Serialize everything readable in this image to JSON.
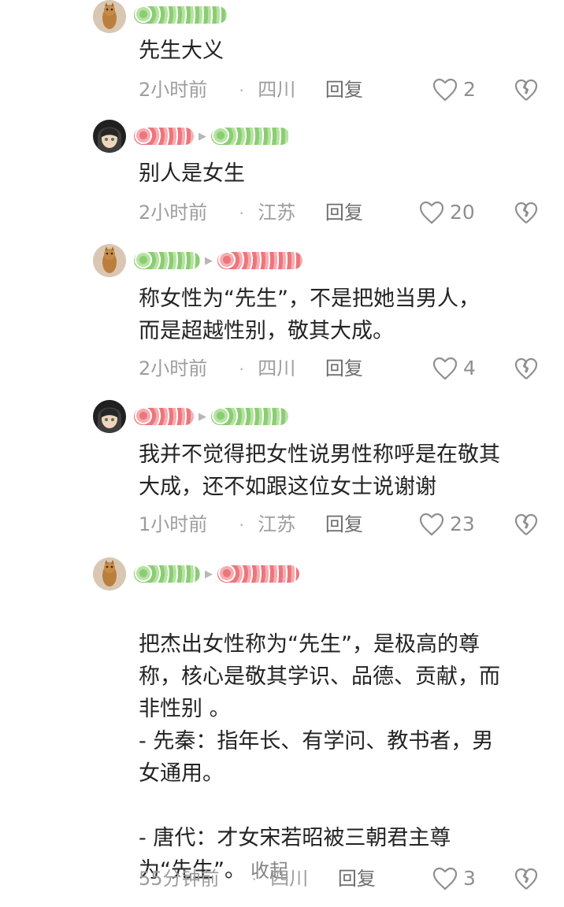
{
  "comments": [
    {
      "text": "先生大义",
      "time": "2小时前",
      "location": "四川",
      "reply_label": "回复",
      "likes": "2",
      "avatar_icon": "cat-avatar-icon"
    },
    {
      "text": "别人是女生",
      "time": "2小时前",
      "location": "江苏",
      "reply_label": "回复",
      "likes": "20",
      "avatar_icon": "anime-avatar-icon"
    },
    {
      "text": "称女性为“先生”，不是把她当男人，\n而是超越性别，敬其大成。",
      "time": "2小时前",
      "location": "四川",
      "reply_label": "回复",
      "likes": "4",
      "avatar_icon": "cat-avatar-icon"
    },
    {
      "text": "我并不觉得把女性说男性称呼是在敬其\n大成，还不如跟这位女士说谢谢",
      "time": "1小时前",
      "location": "江苏",
      "reply_label": "回复",
      "likes": "23",
      "avatar_icon": "anime-avatar-icon"
    },
    {
      "text": "把杰出女性称为“先生”，是极高的尊\n称，核心是敬其学识、品德、贡献，而\n非性别 。\n- 先秦：指年长、有学问、教书者，男\n女通用。\n\n- 唐代：才女宋若昭被三朝君主尊\n为“先生”。",
      "collapse_label": "收起",
      "time": "55分钟前",
      "location": "四川",
      "reply_label": "回复",
      "likes": "3",
      "avatar_icon": "cat-avatar-icon"
    }
  ],
  "colors": {
    "redaction_green": "#62b945",
    "redaction_red": "#e2474e",
    "meta_gray": "#9d9d9d",
    "text": "#232323"
  },
  "icons": {
    "like": "heart-outline-icon",
    "dislike": "broken-heart-outline-icon",
    "separator": "dot-separator-icon"
  }
}
